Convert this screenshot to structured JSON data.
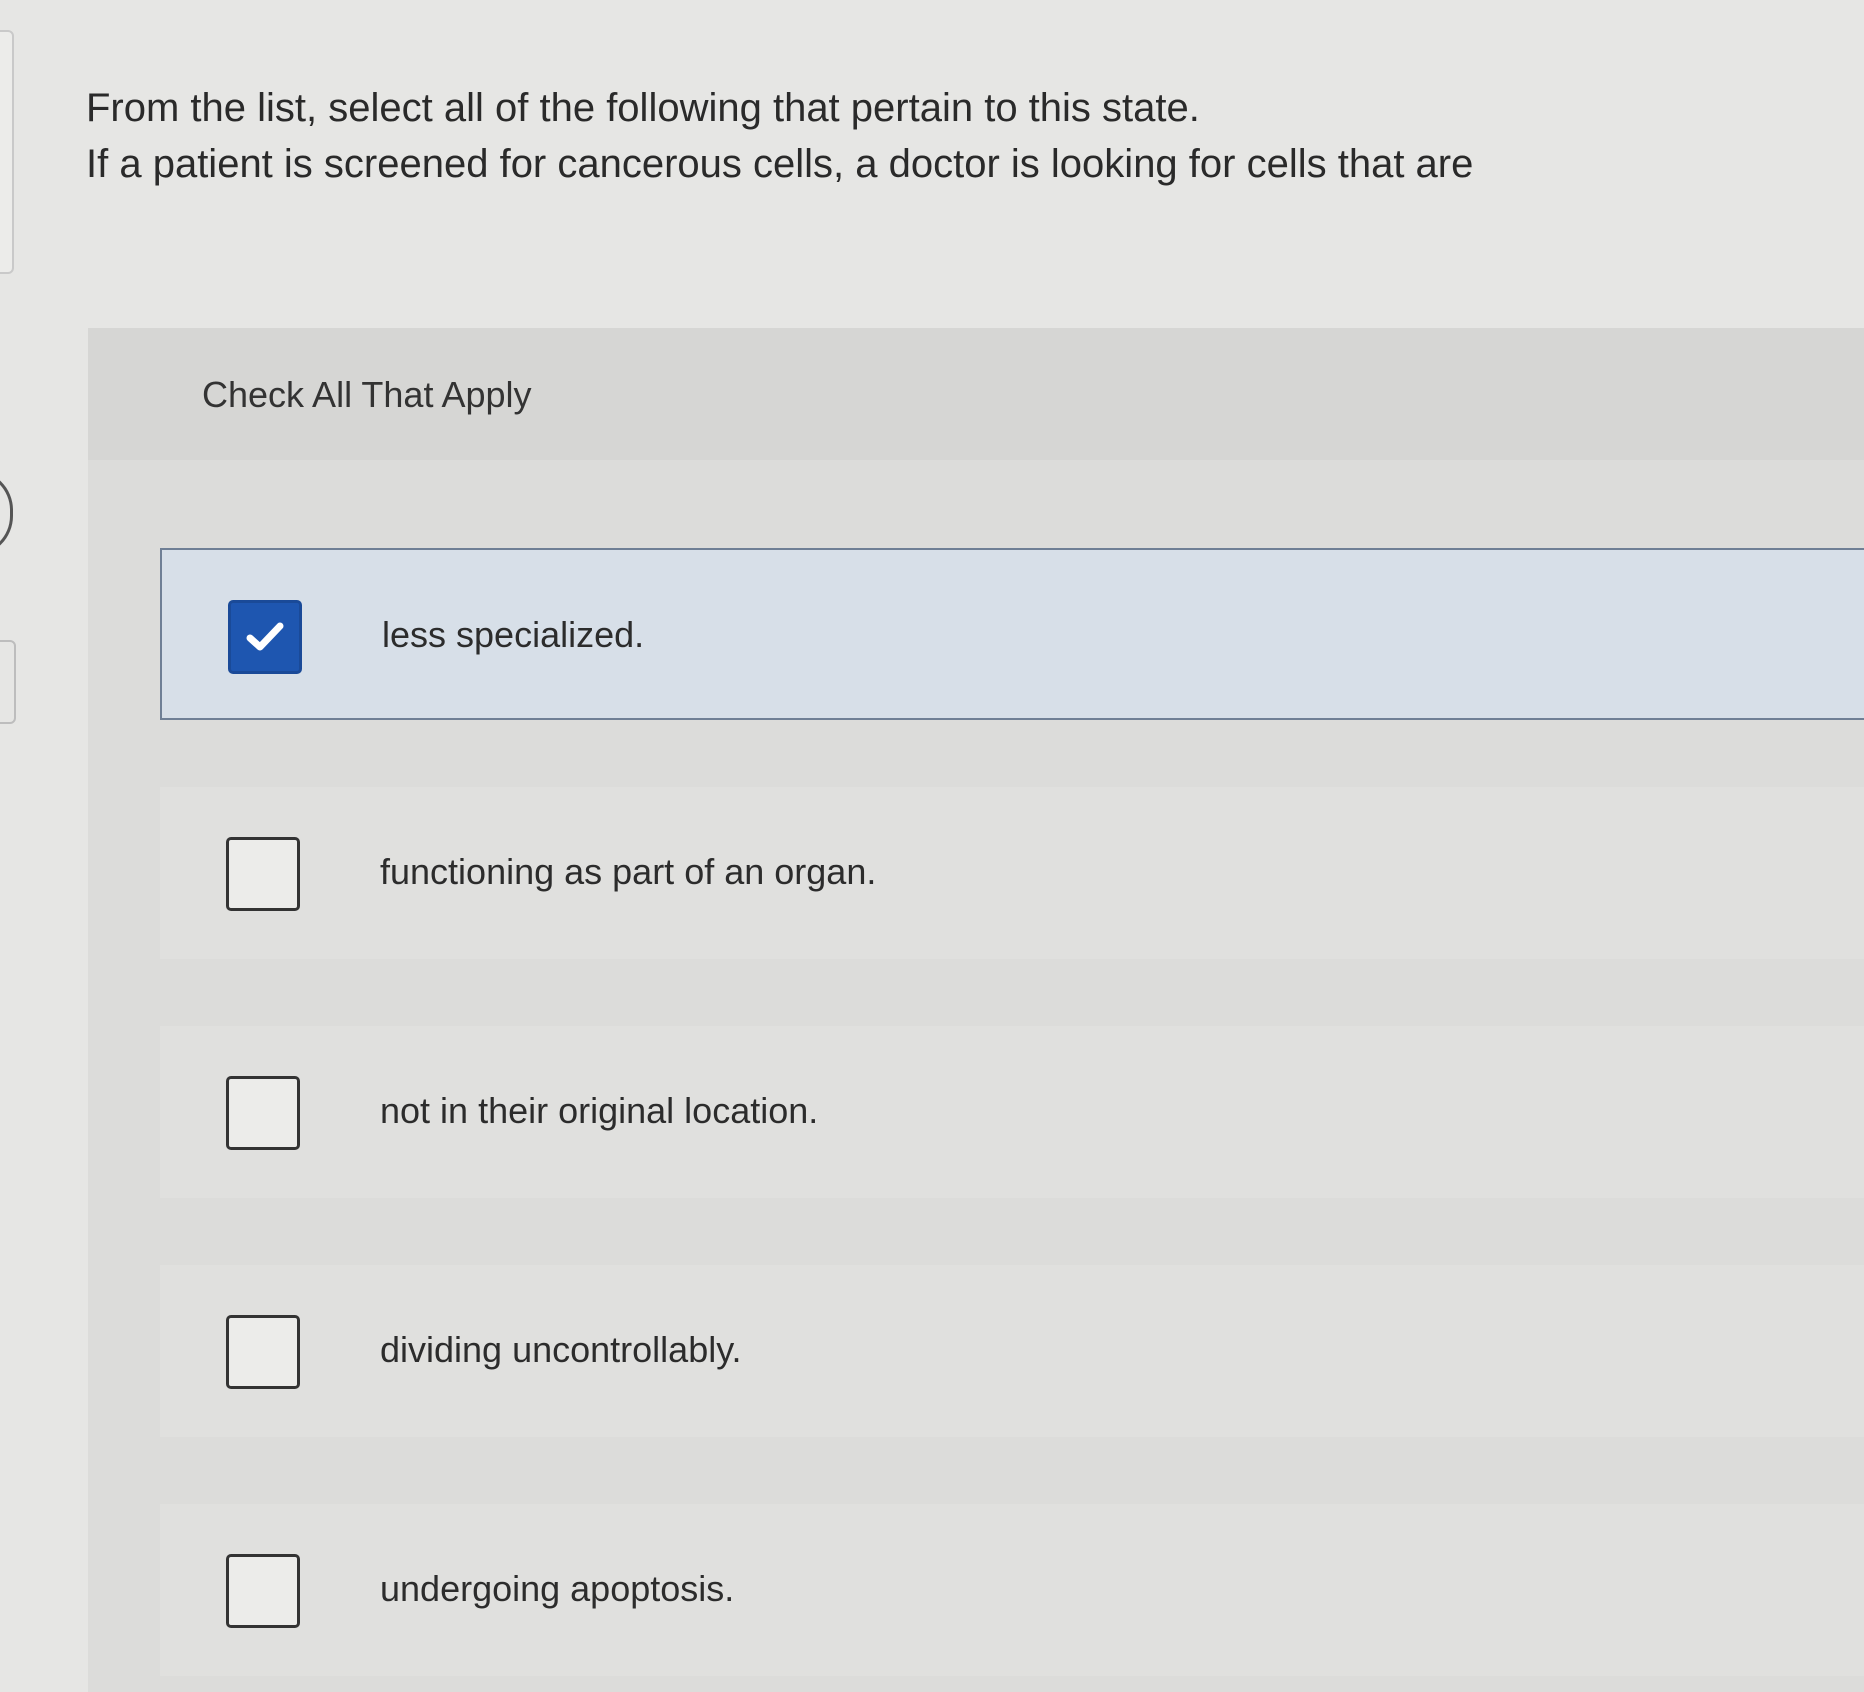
{
  "question": {
    "line1": "From the list, select all of the following that pertain to this state.",
    "line2": "If a patient is screened for cancerous cells, a doctor is looking for cells that are"
  },
  "instruction": "Check All That Apply",
  "options": [
    {
      "label": "less specialized.",
      "checked": true
    },
    {
      "label": "functioning as part of an organ.",
      "checked": false
    },
    {
      "label": "not in their original location.",
      "checked": false
    },
    {
      "label": "dividing uncontrollably.",
      "checked": false
    },
    {
      "label": "undergoing apoptosis.",
      "checked": false
    }
  ],
  "icons": {
    "checked_mark": "check-icon"
  },
  "colors": {
    "checkbox_checked": "#1e56b0",
    "selected_row_bg": "#d7dfe8",
    "selected_row_border": "#6f7f95"
  }
}
